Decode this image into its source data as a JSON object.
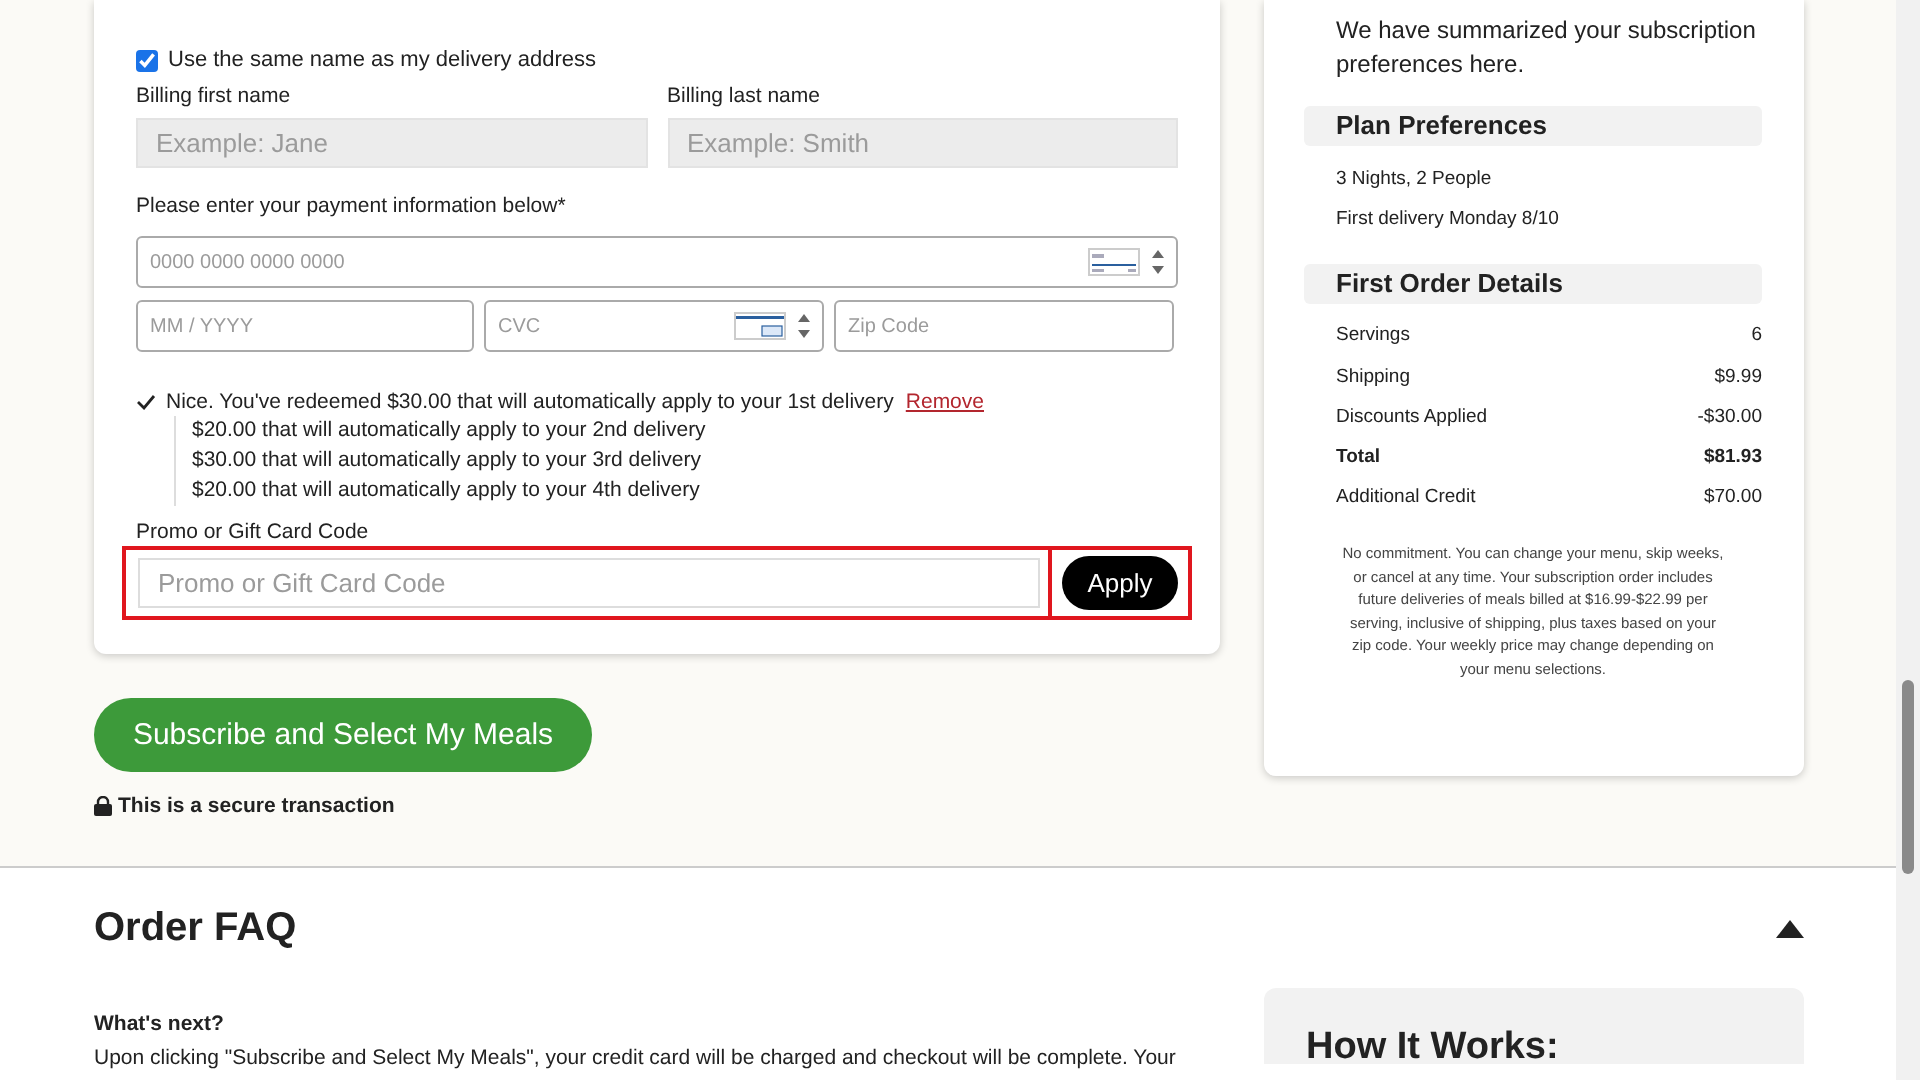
{
  "billing": {
    "same_name": {
      "label": "Use the same name as my delivery address",
      "checked": true
    },
    "first_name": {
      "label": "Billing first name",
      "placeholder": "Example: Jane"
    },
    "last_name": {
      "label": "Billing last name",
      "placeholder": "Example: Smith"
    },
    "payment_prompt": "Please enter your payment information below*",
    "card_number": {
      "placeholder": "0000 0000 0000 0000"
    },
    "expiry": {
      "placeholder": "MM / YYYY"
    },
    "cvc": {
      "placeholder": "CVC"
    },
    "zip": {
      "placeholder": "Zip Code"
    }
  },
  "credits": {
    "first": "Nice. You've redeemed $30.00 that will automatically apply to your 1st delivery",
    "remove_link": "Remove",
    "more": [
      "$20.00 that will automatically apply to your 2nd delivery",
      "$30.00 that will automatically apply to your 3rd delivery",
      "$20.00 that will automatically apply to your 4th delivery"
    ]
  },
  "promo": {
    "label": "Promo or Gift Card Code",
    "placeholder": "Promo or Gift Card Code",
    "button": "Apply",
    "highlighted": true
  },
  "subscribe_button": "Subscribe and Select My Meals",
  "secure_note": "This is a secure transaction",
  "summary": {
    "intro": "We have summarized your subscription preferences here.",
    "sections": [
      {
        "title": "Plan Preferences",
        "rows": [
          {
            "label": "3 Nights, 2 People",
            "kind": "line"
          },
          {
            "label": "First delivery Monday 8/10",
            "kind": "line"
          }
        ]
      },
      {
        "title": "First Order Details",
        "rows": [
          {
            "label": "Servings",
            "value": "6",
            "kind": "line"
          },
          {
            "label": "Shipping",
            "value": "$9.99",
            "kind": "line"
          },
          {
            "label": "Discounts Applied",
            "value": "-$30.00",
            "kind": "line"
          },
          {
            "label": "Total",
            "value": "$81.93",
            "kind": "total"
          },
          {
            "label": "Additional Credit",
            "value": "$70.00",
            "kind": "line"
          }
        ]
      }
    ],
    "disclaimer": "No commitment. You can change your menu, skip weeks, or cancel at any time. Your subscription order includes future deliveries of meals billed at $16.99-$22.99 per serving, inclusive of shipping, plus taxes based on your zip code. Your weekly price may change depending on your menu selections."
  },
  "faq": {
    "title": "Order FAQ",
    "expanded": true,
    "question": "What's next?",
    "answer": "Upon clicking \"Subscribe and Select My Meals\", your credit card will be charged and checkout will be complete. Your"
  },
  "how_it_works": {
    "title": "How It Works:"
  }
}
